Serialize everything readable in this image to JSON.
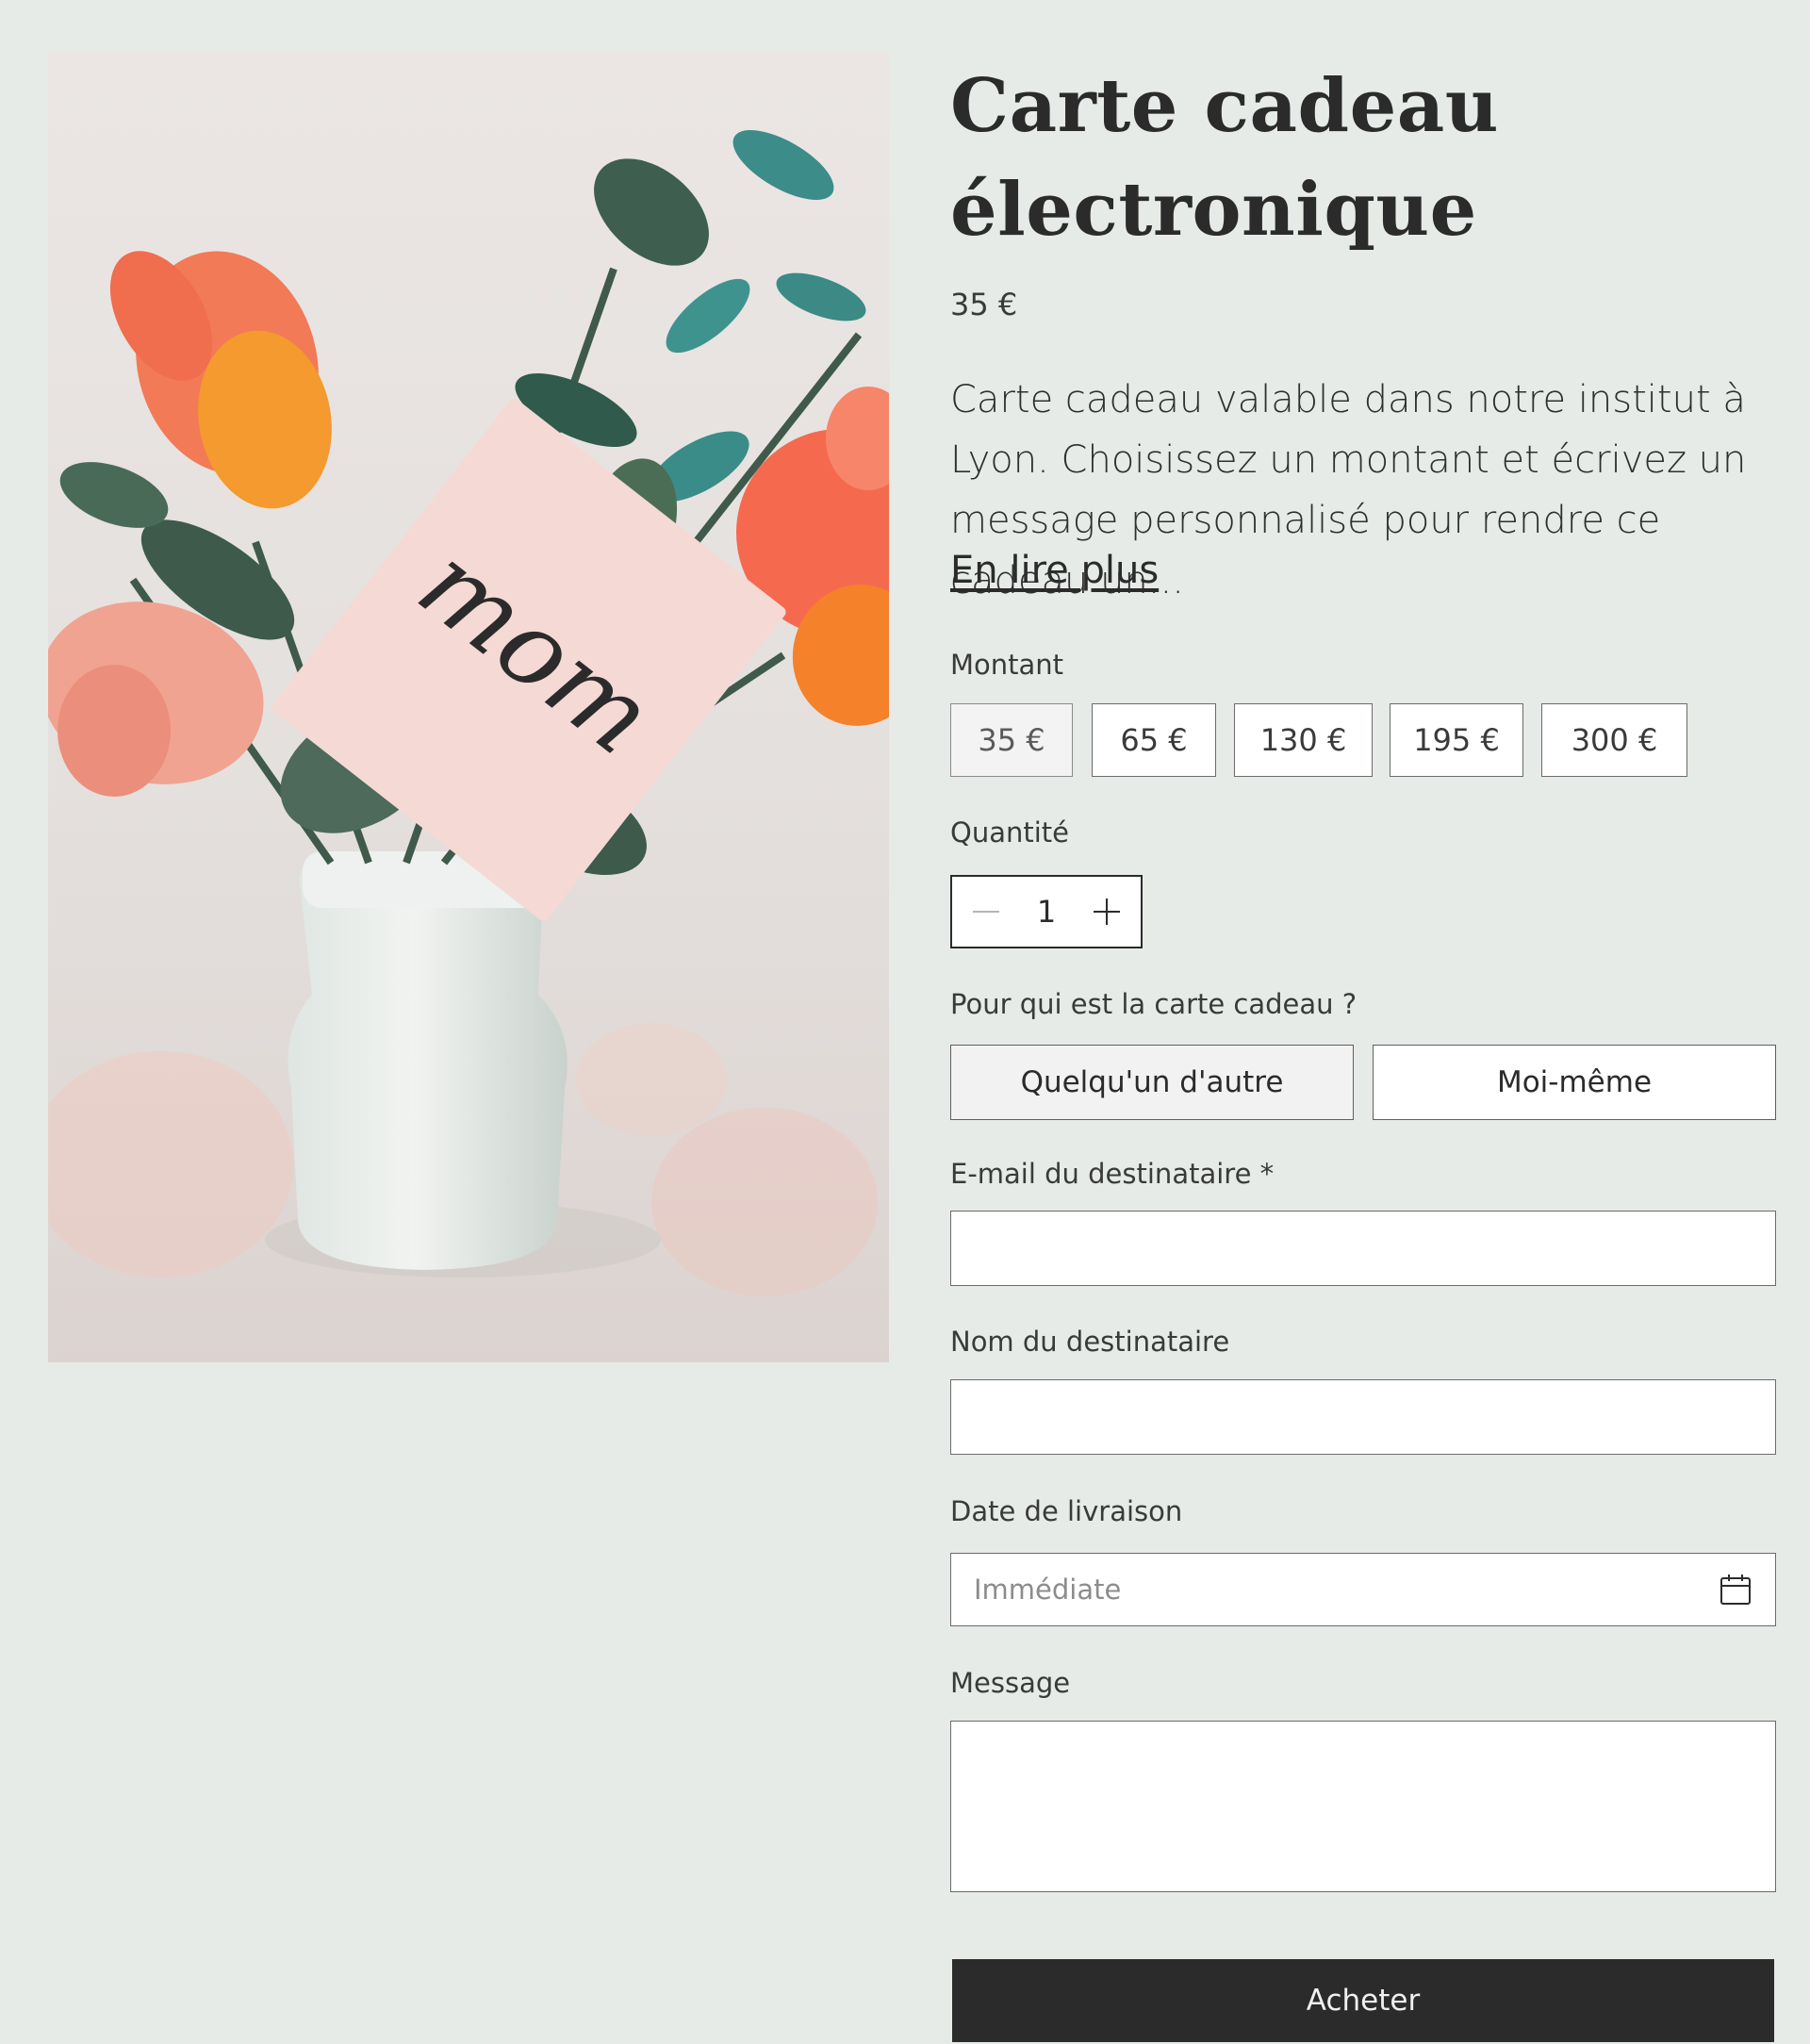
{
  "product": {
    "title_line1": "Carte cadeau",
    "title_line2": "électronique",
    "price": "35 €",
    "description": "Carte cadeau valable dans notre institut à Lyon. Choisissez un montant et écrivez un message personnalisé pour rendre ce cadeau un...",
    "read_more": "En lire plus",
    "image": {
      "card_text": "mom"
    }
  },
  "amount": {
    "label": "Montant",
    "options": [
      "35 €",
      "65 €",
      "130 €",
      "195 €",
      "300 €"
    ],
    "selected": "35 €"
  },
  "quantity": {
    "label": "Quantité",
    "value": "1"
  },
  "recipient_type": {
    "label": "Pour qui est la carte cadeau ?",
    "options": [
      "Quelqu'un d'autre",
      "Moi-même"
    ],
    "selected": "Quelqu'un d'autre"
  },
  "form": {
    "email_label": "E-mail du destinataire *",
    "email_value": "",
    "name_label": "Nom du destinataire",
    "name_value": "",
    "date_label": "Date de livraison",
    "date_placeholder": "Immédiate",
    "message_label": "Message",
    "message_value": ""
  },
  "actions": {
    "buy_label": "Acheter"
  },
  "colors": {
    "background": "#e6ebe8",
    "text": "#2b2b2b",
    "button": "#2b2b2b"
  }
}
